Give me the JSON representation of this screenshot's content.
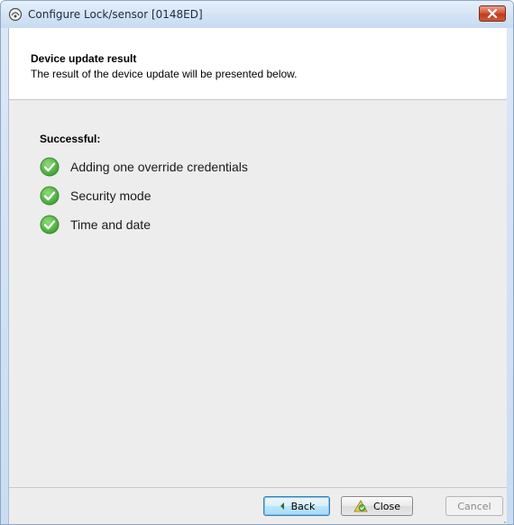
{
  "window": {
    "title": "Configure Lock/sensor [0148ED]"
  },
  "header": {
    "title": "Device update result",
    "subtitle": "The result of the device update will be presented below."
  },
  "results": {
    "section_label": "Successful:",
    "items": [
      {
        "label": "Adding one override credentials",
        "icon": "success-check-icon",
        "status_color": "#4db848"
      },
      {
        "label": "Security mode",
        "icon": "success-check-icon",
        "status_color": "#4db848"
      },
      {
        "label": "Time and date",
        "icon": "success-check-icon",
        "status_color": "#4db848"
      }
    ]
  },
  "footer": {
    "back_label": "Back",
    "close_label": "Close",
    "cancel_label": "Cancel"
  },
  "colors": {
    "close_button": "#c2391b",
    "focus_accent": "#3c7fb1",
    "check_green": "#4db848"
  }
}
